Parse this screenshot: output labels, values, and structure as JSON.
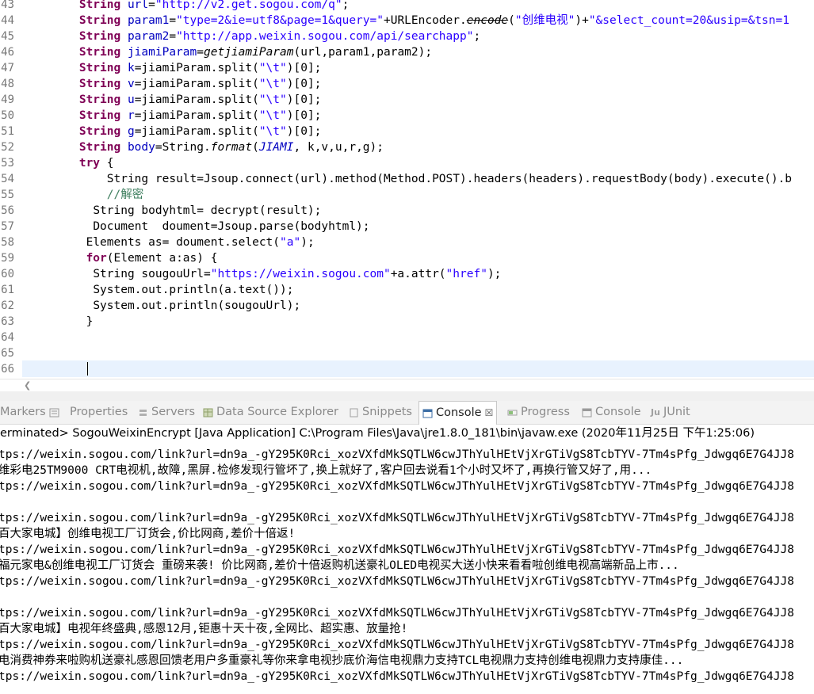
{
  "editor": {
    "gutter": [
      "43",
      "44",
      "45",
      "46",
      "47",
      "48",
      "49",
      "50",
      "51",
      "52",
      "53",
      "54",
      "55",
      "56",
      "57",
      "58",
      "59",
      "60",
      "61",
      "62",
      "63",
      "64",
      "65",
      "66"
    ],
    "lines": {
      "l43": {
        "kw": "String ",
        "a": "url",
        "b": "=",
        "s": "\"http://v2.get.sogou.com/q\"",
        "c": ";"
      },
      "l44": {
        "kw": "String ",
        "a": "param1",
        "b": "=",
        "s": "\"type=2&ie=utf8&page=1&query=\"",
        "c": "+URLEncoder.",
        "d": "encode",
        "e": "(",
        "s2": "\"创维电视\"",
        "f": ")+",
        "s3": "\"&select_count=20&usip=&tsn=1"
      },
      "l45": {
        "kw": "String ",
        "a": "param2",
        "b": "=",
        "s": "\"http://app.weixin.sogou.com/api/searchapp\"",
        "c": ";"
      },
      "l46": {
        "kw": "String ",
        "a": "jiamiParam",
        "b": "=",
        "m": "getjiamiParam",
        "c": "(url,param1,param2);"
      },
      "l47": {
        "kw": "String ",
        "a": "k",
        "b": "=jiamiParam.split(",
        "s": "\"\\t\"",
        "c": ")[0];"
      },
      "l48": {
        "kw": "String ",
        "a": "v",
        "b": "=jiamiParam.split(",
        "s": "\"\\t\"",
        "c": ")[0];"
      },
      "l49": {
        "kw": "String ",
        "a": "u",
        "b": "=jiamiParam.split(",
        "s": "\"\\t\"",
        "c": ")[0];"
      },
      "l50": {
        "kw": "String ",
        "a": "r",
        "b": "=jiamiParam.split(",
        "s": "\"\\t\"",
        "c": ")[0];"
      },
      "l51": {
        "kw": "String ",
        "a": "g",
        "b": "=jiamiParam.split(",
        "s": "\"\\t\"",
        "c": ")[0];"
      },
      "l52": {
        "kw": "String ",
        "a": "body",
        "b": "=String.",
        "m": "format",
        "c": "(",
        "f": "JIAMI",
        "d": ", k,v,u,r,g);"
      },
      "l53": {
        "kw": "try",
        "c": " {"
      },
      "l54": {
        "t": "String result=Jsoup.connect(url).method(Method.POST).headers(headers).requestBody(body).execute().b"
      },
      "l55": {
        "com": "//解密"
      },
      "l56": {
        "t": "String bodyhtml= decrypt(result);"
      },
      "l57": {
        "t": "Document  doument=Jsoup.parse(bodyhtml);"
      },
      "l58": {
        "t": "Elements as= doument.select(",
        "s": "\"a\"",
        "c": ");"
      },
      "l59": {
        "kw": "for",
        "c": "(Element a:as) {"
      },
      "l60": {
        "t": "String sougouUrl=",
        "s": "\"https://weixin.sogou.com\"",
        "c": "+a.attr(",
        "s2": "\"href\"",
        "d": ");"
      },
      "l61": {
        "t": "System.out.println(a.text());"
      },
      "l62": {
        "t": "System.out.println(sougouUrl);"
      },
      "l63": {
        "t": "}"
      }
    }
  },
  "tabs": {
    "markers": "Markers",
    "properties": "Properties",
    "servers": "Servers",
    "datasource": "Data Source Explorer",
    "snippets": "Snippets",
    "console": "Console",
    "close": "☒",
    "progress": "Progress",
    "console2": "Console",
    "junit": "JUnit"
  },
  "status": "erminated> SogouWeixinEncrypt [Java Application] C:\\Program Files\\Java\\jre1.8.0_181\\bin\\javaw.exe (2020年11月25日 下午1:25:06)",
  "console": [
    "tps://weixin.sogou.com/link?url=dn9a_-gY295K0Rci_xozVXfdMkSQTLW6cwJThYulHEtVjXrGTiVgS8TcbTYV-7Tm4sPfg_Jdwgq6E7G4JJ8",
    "维彩电25TM9000 CRT电视机,故障,黑屏.检修发现行管坏了,换上就好了,客户回去说看1个小时又坏了,再换行管又好了,用...",
    "tps://weixin.sogou.com/link?url=dn9a_-gY295K0Rci_xozVXfdMkSQTLW6cwJThYulHEtVjXrGTiVgS8TcbTYV-7Tm4sPfg_Jdwgq6E7G4JJ8",
    "",
    "tps://weixin.sogou.com/link?url=dn9a_-gY295K0Rci_xozVXfdMkSQTLW6cwJThYulHEtVjXrGTiVgS8TcbTYV-7Tm4sPfg_Jdwgq6E7G4JJ8",
    "百大家电城】创维电视工厂订货会,价比网商,差价十倍返!",
    "tps://weixin.sogou.com/link?url=dn9a_-gY295K0Rci_xozVXfdMkSQTLW6cwJThYulHEtVjXrGTiVgS8TcbTYV-7Tm4sPfg_Jdwgq6E7G4JJ8",
    "福元家电&创维电视工厂订货会 重磅来袭! 价比网商,差价十倍返购机送豪礼OLED电视买大送小快来看看啦创维电视高端新品上市...",
    "tps://weixin.sogou.com/link?url=dn9a_-gY295K0Rci_xozVXfdMkSQTLW6cwJThYulHEtVjXrGTiVgS8TcbTYV-7Tm4sPfg_Jdwgq6E7G4JJ8",
    "",
    "tps://weixin.sogou.com/link?url=dn9a_-gY295K0Rci_xozVXfdMkSQTLW6cwJThYulHEtVjXrGTiVgS8TcbTYV-7Tm4sPfg_Jdwgq6E7G4JJ8",
    "百大家电城】电视年终盛典,感恩12月,钜惠十天十夜,全网比、超实惠、放量抢!",
    "tps://weixin.sogou.com/link?url=dn9a_-gY295K0Rci_xozVXfdMkSQTLW6cwJThYulHEtVjXrGTiVgS8TcbTYV-7Tm4sPfg_Jdwgq6E7G4JJ8",
    "电消费神券来啦购机送豪礼感恩回馈老用户多重豪礼等你来拿电视抄底价海信电视鼎力支持TCL电视鼎力支持创维电视鼎力支持康佳...",
    "tps://weixin.sogou.com/link?url=dn9a_-gY295K0Rci_xozVXfdMkSQTLW6cwJThYulHEtVjXrGTiVgS8TcbTYV-7Tm4sPfg_Jdwgq6E7G4JJ8"
  ],
  "colors": {
    "keyword": "#7f0055",
    "string": "#2a00ff",
    "field": "#0000c0",
    "comment": "#3f7f5f",
    "current_line": "#e8f2fe"
  }
}
